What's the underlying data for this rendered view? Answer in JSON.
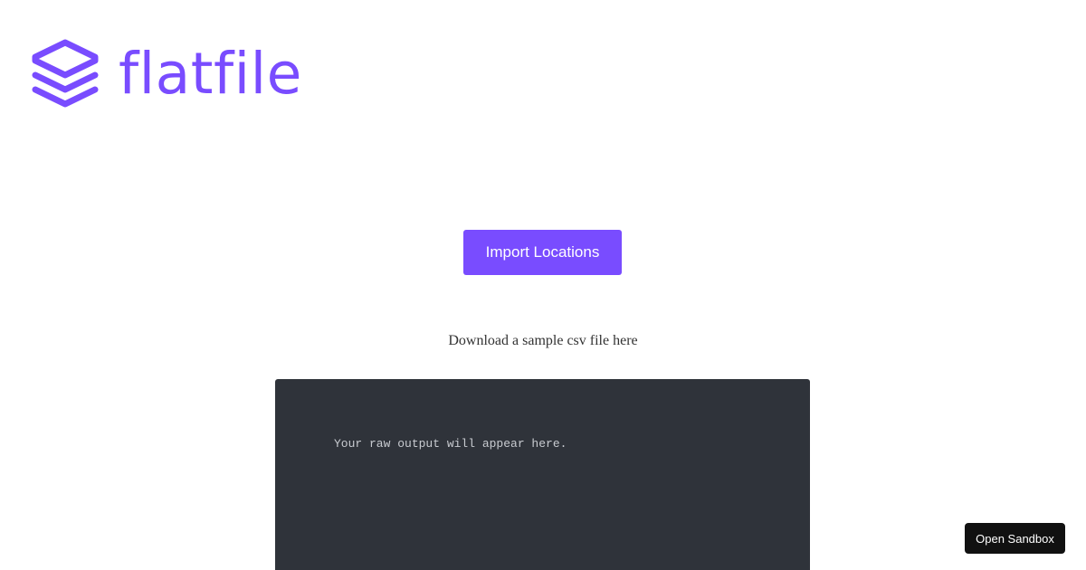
{
  "brand": {
    "name": "flatfile",
    "logo_icon": "layers-stack-icon",
    "color": "#794cff"
  },
  "main": {
    "import_button_label": "Import Locations",
    "download_text": "Download a sample csv file here",
    "output_placeholder": "Your raw output will appear here."
  },
  "sandbox": {
    "button_label": "Open Sandbox"
  },
  "colors": {
    "accent": "#794cff",
    "output_background": "#2f333a",
    "sandbox_background": "#111111"
  }
}
